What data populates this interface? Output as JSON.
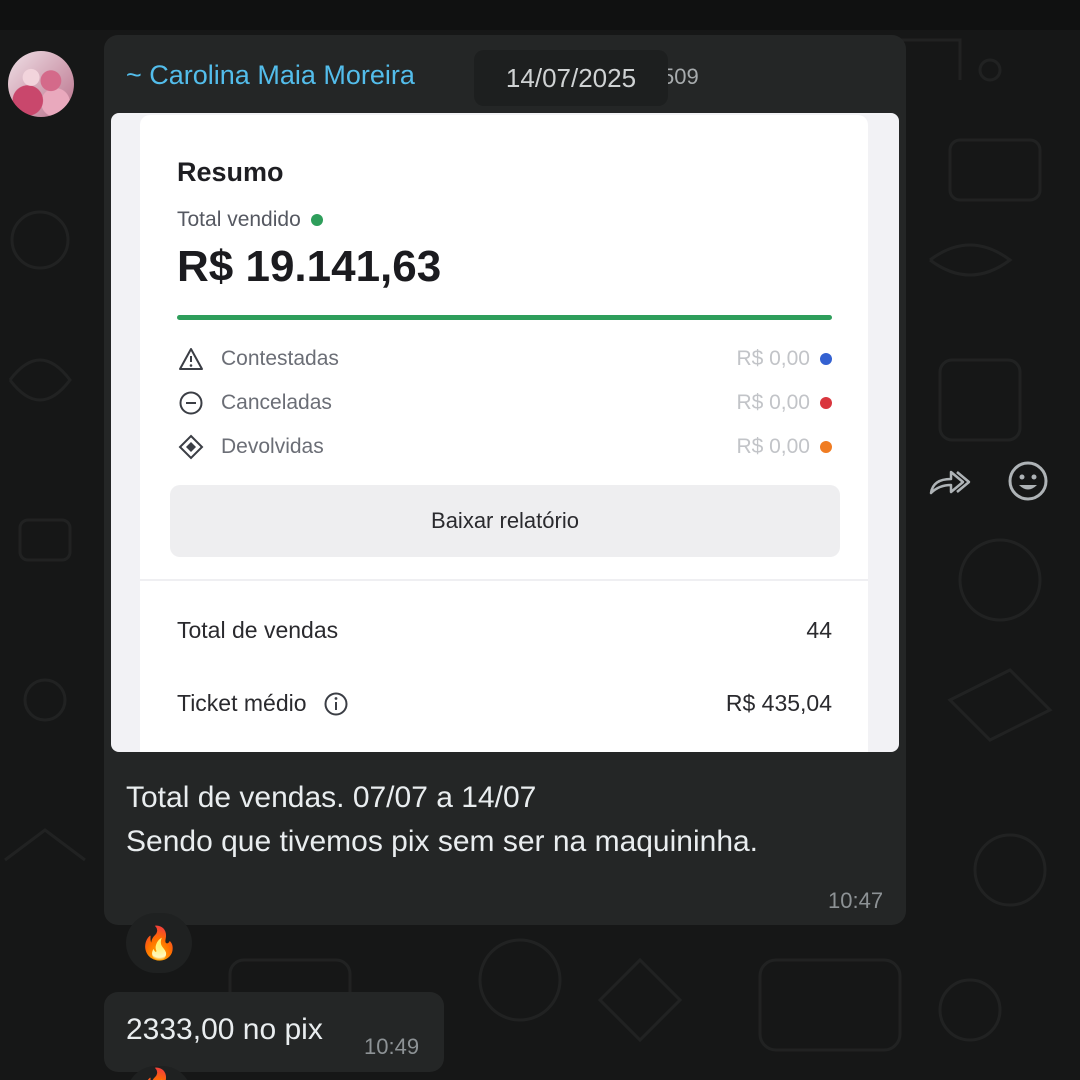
{
  "message": {
    "sender": "~ Carolina Maia Moreira",
    "sender_time_fragment": "509",
    "date_chip": "14/07/2025",
    "text_line1": "Total de vendas. 07/07 a 14/07",
    "text_line2": "Sendo que tivemos pix sem ser na maquininha.",
    "time": "10:47",
    "reaction": "🔥"
  },
  "card": {
    "title": "Resumo",
    "total_label": "Total vendido",
    "total_value": "R$ 19.141,63",
    "progress_fraction": 1.0,
    "rows": [
      {
        "label": "Contestadas",
        "value": "R$ 0,00",
        "dot_color": "#3461d1",
        "icon": "warning-triangle-icon"
      },
      {
        "label": "Canceladas",
        "value": "R$ 0,00",
        "dot_color": "#d9363e",
        "icon": "minus-circle-icon"
      },
      {
        "label": "Devolvidas",
        "value": "R$ 0,00",
        "dot_color": "#f07c22",
        "icon": "return-diamond-icon"
      }
    ],
    "download_button": "Baixar relatório",
    "stats": [
      {
        "label": "Total de vendas",
        "value": "44"
      },
      {
        "label": "Ticket médio",
        "value": "R$ 435,04",
        "icon": "info-icon"
      }
    ]
  },
  "message2": {
    "text": "2333,00 no pix",
    "time": "10:49",
    "reaction": "🔥"
  },
  "colors": {
    "sender": "#53bdeb",
    "bubble": "#242626",
    "background": "#161717",
    "accent_green": "#2e9e5b"
  },
  "icons": [
    "forward-icon",
    "emoji-icon"
  ]
}
